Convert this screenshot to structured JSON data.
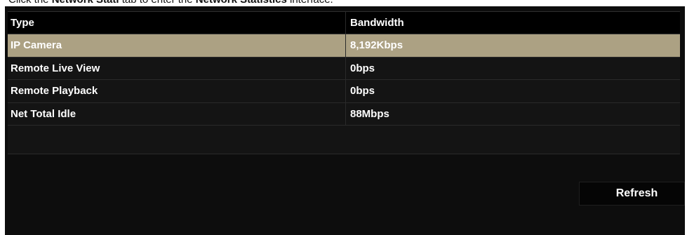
{
  "caption": {
    "prefix": "Click the ",
    "tab_name": "Network Stati",
    "middle": " tab to enter the ",
    "interface_name": "Network Statistics",
    "suffix": " interface."
  },
  "table": {
    "headers": [
      "Type",
      "Bandwidth"
    ],
    "rows": [
      {
        "type": "IP Camera",
        "bandwidth": "8,192Kbps",
        "selected": true
      },
      {
        "type": "Remote Live View",
        "bandwidth": "0bps",
        "selected": false
      },
      {
        "type": "Remote Playback",
        "bandwidth": "0bps",
        "selected": false
      },
      {
        "type": "Net Total Idle",
        "bandwidth": "88Mbps",
        "selected": false
      }
    ]
  },
  "buttons": {
    "refresh_label": "Refresh"
  },
  "colors": {
    "selected_row": "#aca183",
    "panel_bg": "#0d0d0d",
    "header_bg": "#000000"
  }
}
